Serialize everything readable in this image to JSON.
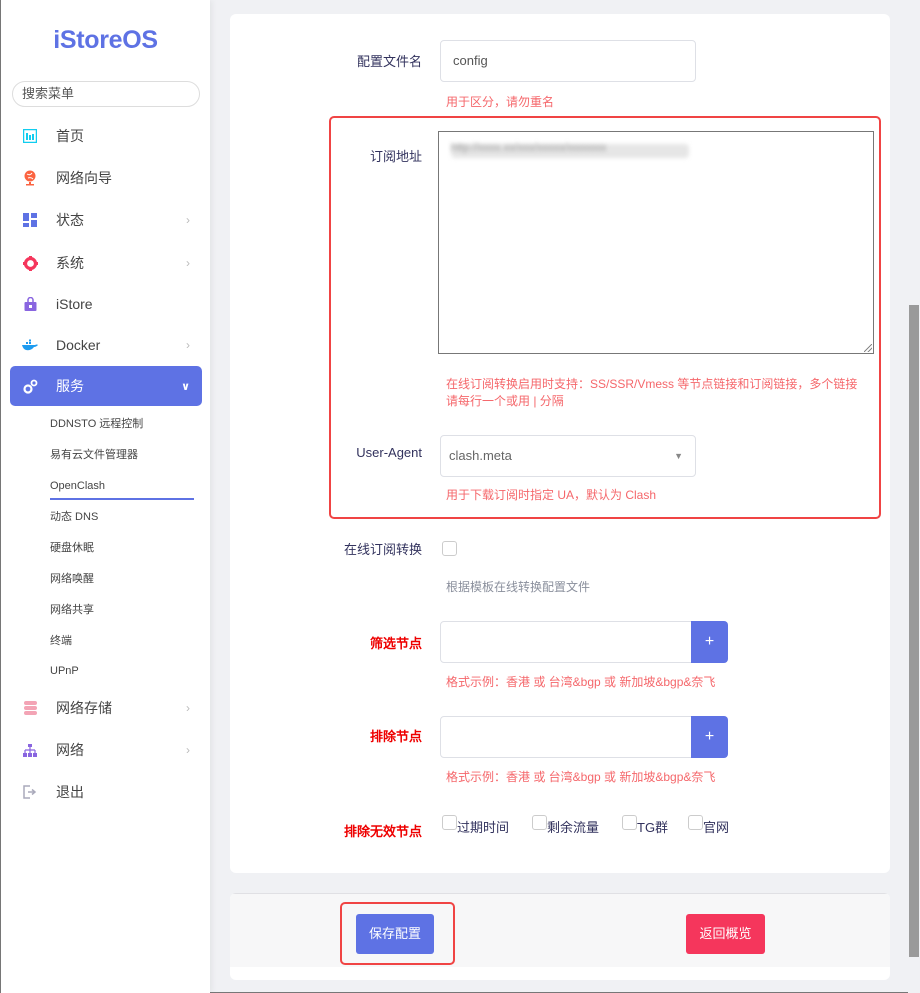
{
  "sidebar": {
    "logo": "iStoreOS",
    "search_placeholder": "搜索菜单",
    "items": [
      {
        "label": "首页",
        "icon": "dashboard-icon",
        "has_chevron": false
      },
      {
        "label": "网络向导",
        "icon": "globe-icon",
        "has_chevron": false
      },
      {
        "label": "状态",
        "icon": "grid-icon",
        "has_chevron": true
      },
      {
        "label": "系统",
        "icon": "gear-icon",
        "has_chevron": true
      },
      {
        "label": "iStore",
        "icon": "store-bag-icon",
        "has_chevron": false
      },
      {
        "label": "Docker",
        "icon": "docker-whale-icon",
        "has_chevron": true
      },
      {
        "label": "服务",
        "icon": "cogs-icon",
        "has_chevron": true,
        "active": true
      },
      {
        "label": "网络存储",
        "icon": "database-icon",
        "has_chevron": true
      },
      {
        "label": "网络",
        "icon": "network-tree-icon",
        "has_chevron": true
      },
      {
        "label": "退出",
        "icon": "logout-icon",
        "has_chevron": false
      }
    ],
    "sub_items": [
      {
        "label": "DDNSTO 远程控制"
      },
      {
        "label": "易有云文件管理器"
      },
      {
        "label": "OpenClash",
        "active": true
      },
      {
        "label": "动态 DNS"
      },
      {
        "label": "硬盘休眠"
      },
      {
        "label": "网络唤醒"
      },
      {
        "label": "网络共享"
      },
      {
        "label": "终端"
      },
      {
        "label": "UPnP"
      }
    ]
  },
  "form": {
    "config_name": {
      "label": "配置文件名",
      "value": "config",
      "hint": "用于区分，请勿重名"
    },
    "subscription_url": {
      "label": "订阅地址",
      "value_redacted": "http://xxxx.xx/xxx/xxxxx/xxxxxxx",
      "hint": "在线订阅转换启用时支持：SS/SSR/Vmess 等节点链接和订阅链接，多个链接请每行一个或用 | 分隔"
    },
    "user_agent": {
      "label": "User-Agent",
      "value": "clash.meta",
      "hint": "用于下载订阅时指定 UA，默认为 Clash"
    },
    "online_convert": {
      "label": "在线订阅转换",
      "checked": false,
      "hint": "根据模板在线转换配置文件"
    },
    "filter_nodes": {
      "label": "筛选节点",
      "value": "",
      "add_label": "+",
      "hint": "格式示例：香港 或 台湾&bgp 或 新加坡&bgp&奈飞"
    },
    "exclude_nodes": {
      "label": "排除节点",
      "value": "",
      "add_label": "+",
      "hint": "格式示例：香港 或 台湾&bgp 或 新加坡&bgp&奈飞"
    },
    "exclude_invalid": {
      "label": "排除无效节点",
      "options": [
        {
          "label": "过期时间",
          "checked": false
        },
        {
          "label": "剩余流量",
          "checked": false
        },
        {
          "label": "TG群",
          "checked": false
        },
        {
          "label": "官网",
          "checked": false
        }
      ]
    }
  },
  "actions": {
    "save_label": "保存配置",
    "back_label": "返回概览"
  },
  "colors": {
    "accent": "#5e72e4",
    "danger": "#f5365c",
    "hint_red": "#f5676b",
    "highlight_box": "#f04444"
  }
}
